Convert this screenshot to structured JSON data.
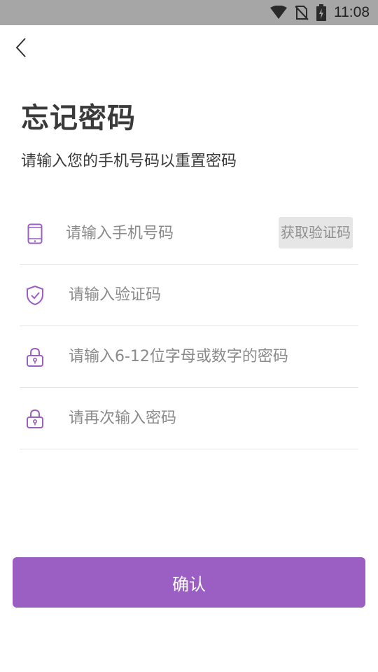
{
  "status_bar": {
    "time": "11:08",
    "icons": [
      "wifi-icon",
      "no-sim-icon",
      "battery-charging-icon"
    ]
  },
  "nav": {
    "back_icon": "chevron-left-icon"
  },
  "header": {
    "title": "忘记密码",
    "subtitle": "请输入您的手机号码以重置密码"
  },
  "form": {
    "phone": {
      "placeholder": "请输入手机号码",
      "value": "",
      "icon": "phone-icon"
    },
    "get_code_label": "获取验证码",
    "code": {
      "placeholder": "请输入验证码",
      "value": "",
      "icon": "shield-check-icon"
    },
    "password": {
      "placeholder": "请输入6-12位字母或数字的密码",
      "value": "",
      "icon": "lock-icon"
    },
    "confirm_password": {
      "placeholder": "请再次输入密码",
      "value": "",
      "icon": "lock-icon"
    }
  },
  "confirm_label": "确认",
  "colors": {
    "accent": "#9b5fc4",
    "status_bar": "#a6a6a6",
    "text": "#3a3a3a"
  }
}
